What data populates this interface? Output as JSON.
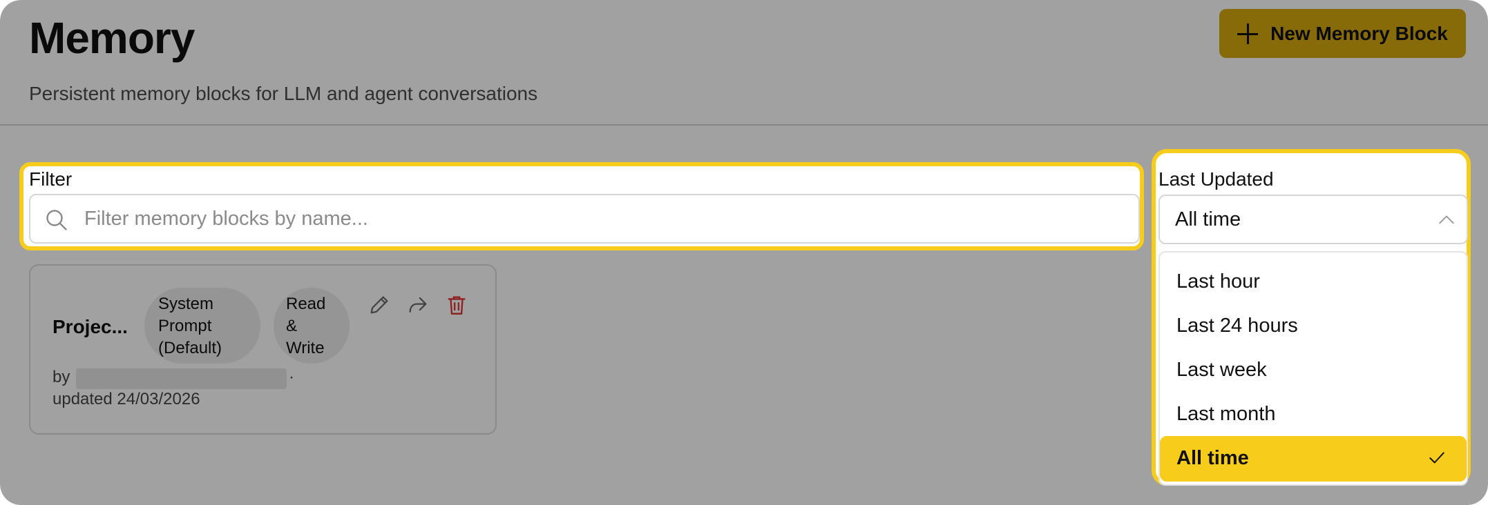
{
  "header": {
    "title": "Memory",
    "subtitle": "Persistent memory blocks for LLM and agent conversations",
    "new_button_label": "New Memory Block"
  },
  "filter": {
    "label": "Filter",
    "placeholder": "Filter memory blocks by name..."
  },
  "last_updated": {
    "label": "Last Updated",
    "selected": "All time",
    "options": [
      "Last hour",
      "Last 24 hours",
      "Last week",
      "Last month",
      "All time"
    ]
  },
  "card": {
    "title": "Projec...",
    "tag_type": [
      "System",
      "Prompt",
      "(Default)"
    ],
    "tag_access": [
      "Read",
      "&",
      "Write"
    ],
    "by_label": "by",
    "separator": "·",
    "updated": "updated 24/03/2026"
  },
  "colors": {
    "accent": "#f8cc1b",
    "button": "#d6aa0e",
    "delete": "#e03a3a"
  },
  "icons": [
    "plus-icon",
    "search-icon",
    "edit-icon",
    "share-icon",
    "trash-icon",
    "chevron-up-icon",
    "check-icon"
  ]
}
